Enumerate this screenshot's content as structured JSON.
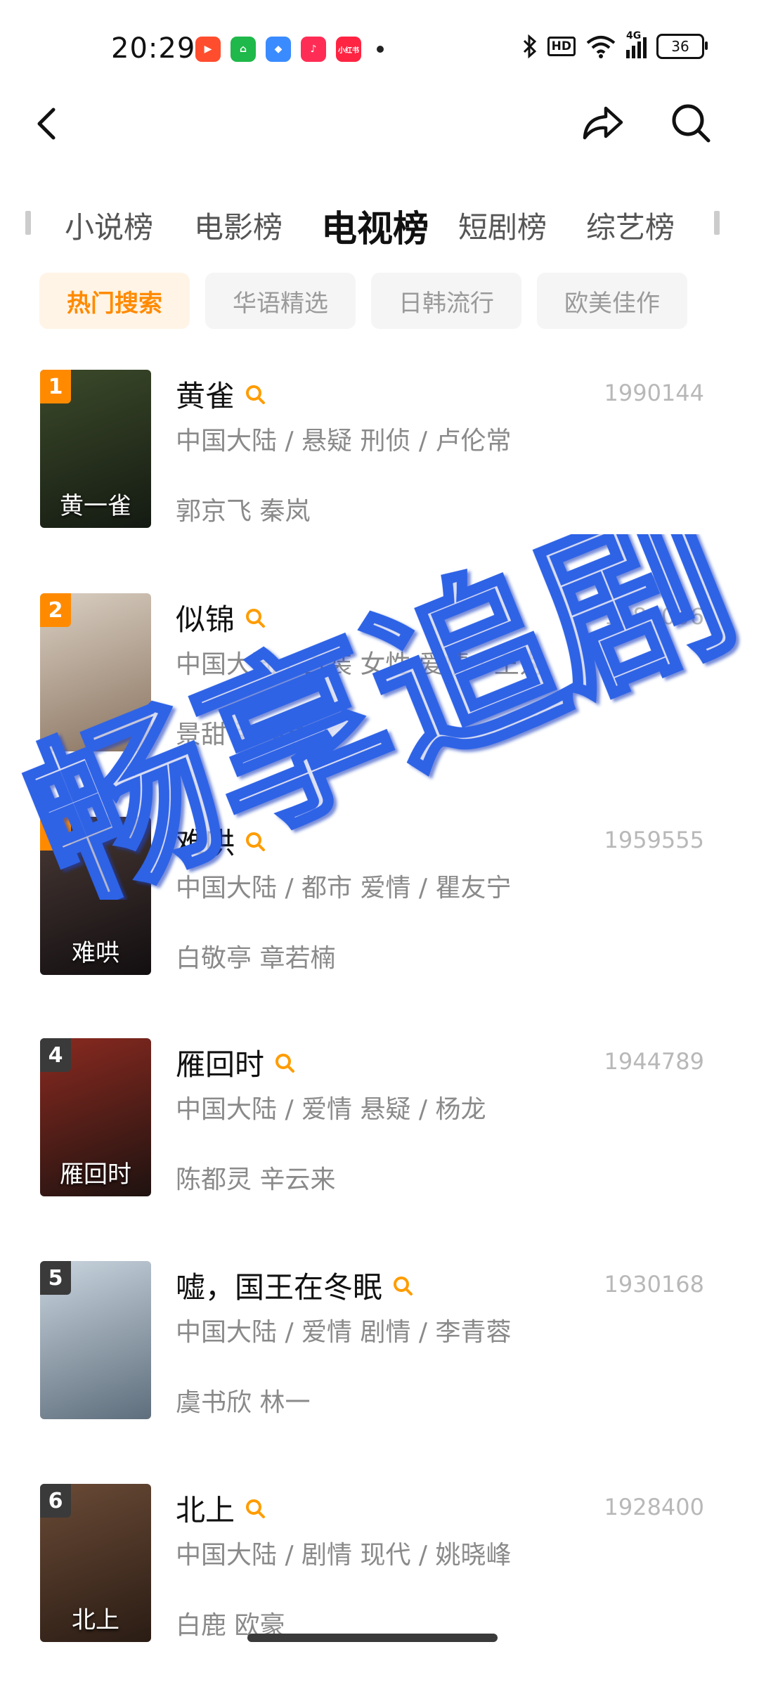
{
  "status_bar": {
    "time": "20:29",
    "network": "4G",
    "hd": "HD",
    "battery": "36",
    "app_icons": [
      {
        "name": "video-app-icon",
        "color": "#ff4d2e"
      },
      {
        "name": "shop-app-icon",
        "color": "#1fb84a"
      },
      {
        "name": "blue-app-icon",
        "color": "#3a8bff"
      },
      {
        "name": "music-app-icon",
        "color": "#ff2d55"
      },
      {
        "name": "redbook-app-icon",
        "color": "#ff2442",
        "label": "小红书"
      }
    ]
  },
  "category_tabs": [
    "小说榜",
    "电影榜",
    "电视榜",
    "短剧榜",
    "综艺榜"
  ],
  "active_tab": "电视榜",
  "filter_chips": [
    "热门搜索",
    "华语精选",
    "日韩流行",
    "欧美佳作"
  ],
  "active_chip": "热门搜索",
  "rankings": [
    {
      "rank": "1",
      "title": "黄雀",
      "poster_title": "黄一雀",
      "score": "1990144",
      "meta": "中国大陆 / 悬疑 刑侦 / 卢伦常",
      "cast": "郭京飞 秦岚",
      "rank_color": "#ff8a00",
      "poster_colors": [
        "#3c4a2a",
        "#141a12"
      ]
    },
    {
      "rank": "2",
      "title": "似锦",
      "poster_title": "",
      "score": "1989006",
      "meta": "中国大陆 / 古装 女性 爱情 / 王为",
      "cast": "景甜 张晚意",
      "rank_color": "#ff8a00",
      "poster_colors": [
        "#d9cfc2",
        "#8a7360"
      ]
    },
    {
      "rank": "3",
      "title": "难哄",
      "poster_title": "难哄",
      "score": "1959555",
      "meta": "中国大陆 / 都市 爱情 / 瞿友宁",
      "cast": "白敬亭 章若楠",
      "rank_color": "#ff8a00",
      "poster_colors": [
        "#4a3a36",
        "#120e10"
      ]
    },
    {
      "rank": "4",
      "title": "雁回时",
      "poster_title": "雁回时",
      "score": "1944789",
      "meta": "中国大陆 / 爱情 悬疑 / 杨龙",
      "cast": "陈都灵 辛云来",
      "rank_color": "#3a3a3a",
      "poster_colors": [
        "#8a2a20",
        "#1e1210"
      ]
    },
    {
      "rank": "5",
      "title": "嘘，国王在冬眠",
      "poster_title": "",
      "score": "1930168",
      "meta": "中国大陆 / 爱情 剧情 / 李青蓉",
      "cast": "虞书欣 林一",
      "rank_color": "#3a3a3a",
      "poster_colors": [
        "#c9d4de",
        "#5e6e7c"
      ]
    },
    {
      "rank": "6",
      "title": "北上",
      "poster_title": "北上",
      "score": "1928400",
      "meta": "中国大陆 / 剧情 现代 / 姚晓峰",
      "cast": "白鹿 欧豪",
      "rank_color": "#3a3a3a",
      "poster_colors": [
        "#6a4a36",
        "#2a1c14"
      ]
    }
  ],
  "watermark_text": "畅享追剧"
}
